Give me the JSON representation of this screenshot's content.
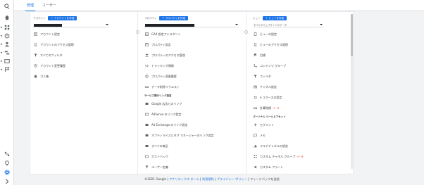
{
  "tabs": {
    "admin": "管理",
    "users": "ユーザー"
  },
  "rail_icons": [
    "search-icon",
    "home-icon",
    "customization-icon",
    "realtime-icon",
    "audience-icon",
    "acquisition-icon",
    "behavior-icon",
    "conversions-icon",
    "attribution-icon",
    "discover-icon",
    "settings-icon",
    "expand-icon"
  ],
  "account": {
    "label": "アカウント",
    "create": "＋ アカウントを作成",
    "items": [
      "アカウント設定",
      "アカウントのアクセス管理",
      "すべてのフィルタ",
      "アカウント変更履歴",
      "ゴミ箱"
    ]
  },
  "property": {
    "label": "プロパティ",
    "create": "＋ プロパティを作成",
    "items": [
      "GA4 設定アシスタント",
      "プロパティ設定",
      "プロパティのアクセス管理",
      "トラッキング情報",
      "プロパティ変更履歴",
      "データ削除リクエスト"
    ],
    "section": "サービス間のリンク設定",
    "links": [
      "Google 広告とのリンク",
      "AdSense のリンク設定",
      "Ad Exchange のリンク設定",
      "オプティマイズとタグ マネージャーのリンク設定",
      "すべての商品",
      "ポストバック",
      "ユーザー定義"
    ]
  },
  "view": {
    "label": "ビュー",
    "create": "＋ ビューを作成",
    "selected": "すべてのウェブサイトのデータ",
    "items": [
      "ビューの設定",
      "ビューのアクセス管理",
      "目標",
      "コンテンツ グループ",
      "フィルタ",
      "チャネル設定",
      "e コマースの設定",
      "計算指標"
    ],
    "beta": "ベータ",
    "section": "パーソナル ツールとアセット",
    "tools": [
      "セグメント",
      "メモ",
      "マルチチャネルの設定",
      "カスタム チャネル グループ",
      "カスタム アラート"
    ]
  },
  "footer": {
    "copyright": "©2021 Google |",
    "home": "アナリティクス ホーム",
    "sep1": "|",
    "terms": "利用規約",
    "sep2": "|",
    "privacy": "プライバシー ポリシー",
    "sep3": "|",
    "feedback": "フィードバックを送信"
  },
  "colors": {
    "accent": "#1a73e8",
    "beta": "#d93025"
  }
}
